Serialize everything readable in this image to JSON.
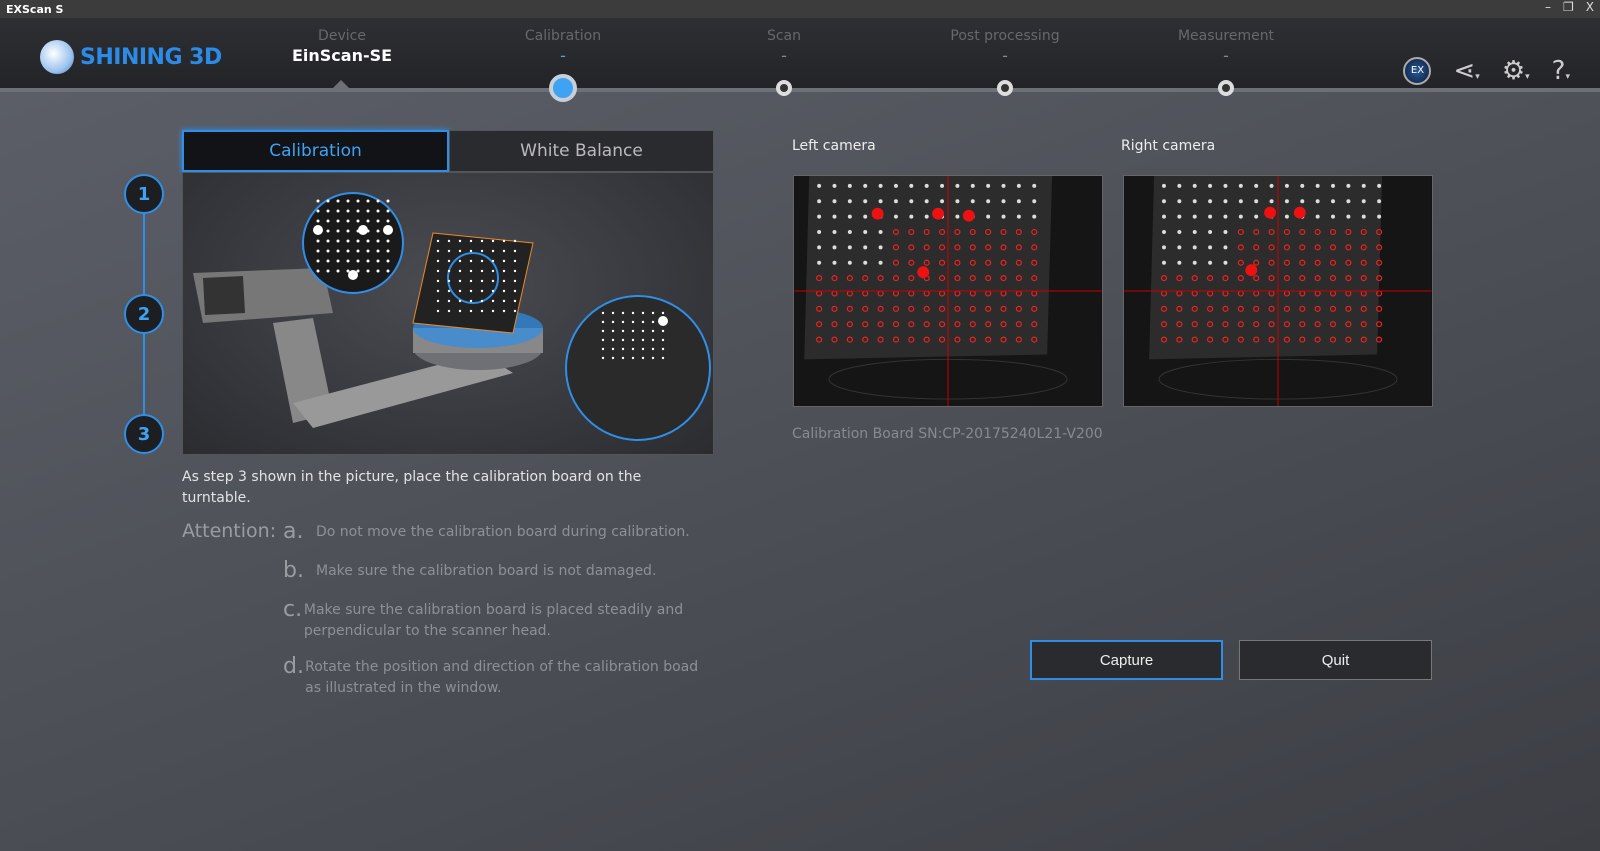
{
  "window": {
    "title": "EXScan S",
    "minimize": "–",
    "restore": "❐",
    "close": "X"
  },
  "header": {
    "logo": "SHINING 3D",
    "steps": [
      {
        "label": "Device",
        "value": "EinScan-SE"
      },
      {
        "label": "Calibration",
        "value": "-"
      },
      {
        "label": "Scan",
        "value": "-"
      },
      {
        "label": "Post processing",
        "value": "-"
      },
      {
        "label": "Measurement",
        "value": "-"
      }
    ],
    "tools": {
      "exscan": "EX",
      "share": "⋖",
      "settings": "⚙",
      "help": "?",
      "caret": "▾"
    }
  },
  "tabs": {
    "calibration": "Calibration",
    "white_balance": "White Balance"
  },
  "step_numbers": [
    "1",
    "2",
    "3"
  ],
  "instruction": "As step 3 shown in the picture, place the calibration board on the turntable.",
  "attention": {
    "label": "Attention:",
    "items": [
      {
        "key": "a.",
        "text": "Do not move the calibration board during calibration."
      },
      {
        "key": "b.",
        "text": "Make sure the calibration board is not damaged."
      },
      {
        "key": "c.",
        "text": "Make sure the calibration board is placed steadily and perpendicular to the scanner head."
      },
      {
        "key": "d.",
        "text": "Rotate the position and direction of the calibration boad as illustrated in the window."
      }
    ]
  },
  "cameras": {
    "left": "Left camera",
    "right": "Right camera"
  },
  "serial": "Calibration Board SN:CP-20175240L21-V200",
  "buttons": {
    "capture": "Capture",
    "quit": "Quit"
  }
}
